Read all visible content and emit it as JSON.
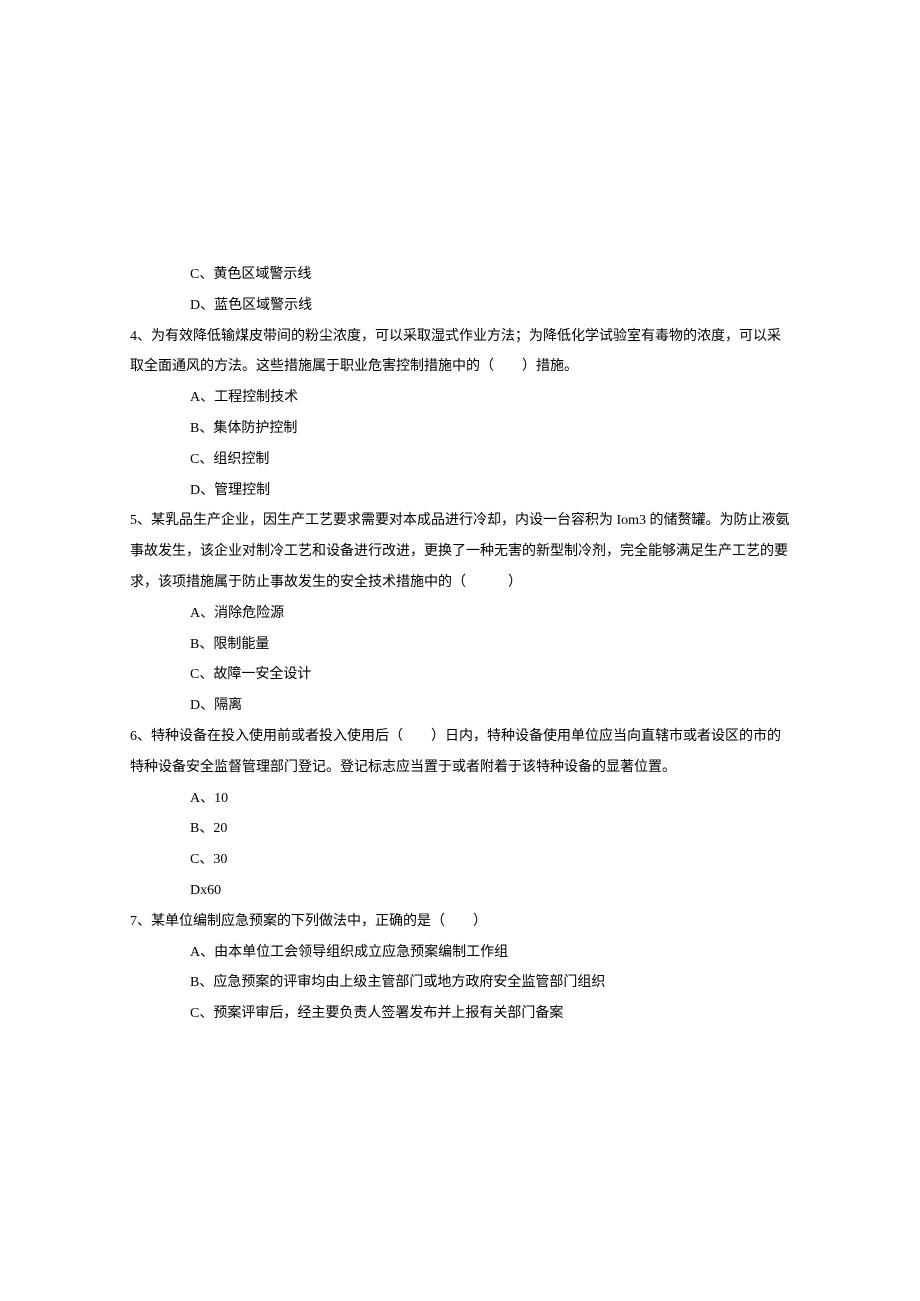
{
  "q3": {
    "options": {
      "c": "C、黄色区域警示线",
      "d": "D、蓝色区域警示线"
    }
  },
  "q4": {
    "stem": "4、为有效降低输煤皮带间的粉尘浓度，可以采取湿式作业方法；为降低化学试验室有毒物的浓度，可以采取全面通风的方法。这些措施属于职业危害控制措施中的（　　）措施。",
    "options": {
      "a": "A、工程控制技术",
      "b": "B、集体防护控制",
      "c": "C、组织控制",
      "d": "D、管理控制"
    }
  },
  "q5": {
    "stem": "5、某乳品生产企业，因生产工艺要求需要对本成品进行冷却，内设一台容积为 Iom3 的储赘罐。为防止液氨事故发生，该企业对制冷工艺和设备进行改进，更换了一种无害的新型制冷剂，完全能够满足生产工艺的要求，该项措施属于防止事故发生的安全技术措施中的（　　　）",
    "options": {
      "a": "A、消除危险源",
      "b": "B、限制能量",
      "c": "C、故障一安全设计",
      "d": "D、隔离"
    }
  },
  "q6": {
    "stem": "6、特种设备在投入使用前或者投入使用后（　　）日内，特种设备使用单位应当向直辖市或者设区的市的特种设备安全监督管理部门登记。登记标志应当置于或者附着于该特种设备的显著位置。",
    "options": {
      "a": "A、10",
      "b": "B、20",
      "c": "C、30",
      "d": "Dx60"
    }
  },
  "q7": {
    "stem": "7、某单位编制应急预案的下列做法中，正确的是（　　）",
    "options": {
      "a": "A、由本单位工会领导组织成立应急预案编制工作组",
      "b": "B、应急预案的评审均由上级主管部门或地方政府安全监管部门组织",
      "c": "C、预案评审后，经主要负责人签署发布并上报有关部门备案"
    }
  }
}
